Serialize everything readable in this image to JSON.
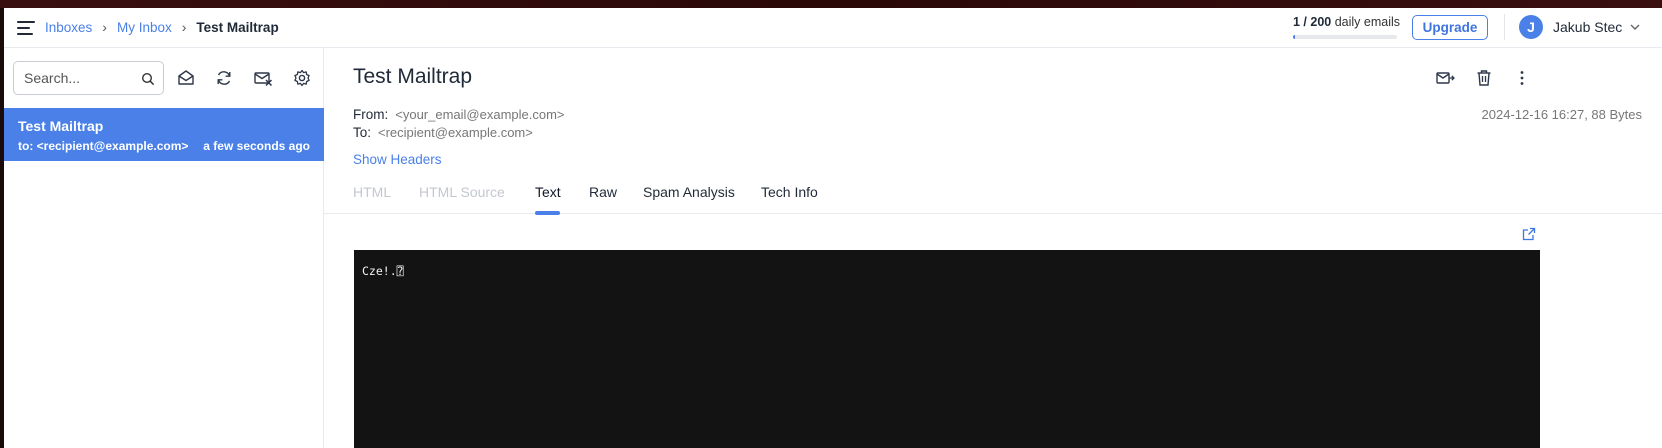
{
  "header": {
    "breadcrumbs": [
      "Inboxes",
      "My Inbox",
      "Test Mailtrap"
    ],
    "quota_used": "1 / 200",
    "quota_label": " daily emails",
    "quota_fraction": 0.005,
    "upgrade_label": "Upgrade",
    "user_initial": "J",
    "user_name": "Jakub Stec"
  },
  "sidebar": {
    "search_placeholder": "Search...",
    "toolbar_icons": [
      "mark-read-icon",
      "refresh-icon",
      "clear-inbox-icon",
      "settings-icon"
    ],
    "messages": [
      {
        "subject": "Test Mailtrap",
        "to": "to: <recipient@example.com>",
        "time": "a few seconds ago",
        "selected": true
      }
    ]
  },
  "message": {
    "subject": "Test Mailtrap",
    "from_label": "From:",
    "from_value": "<your_email@example.com>",
    "to_label": "To:",
    "to_value": "<recipient@example.com>",
    "meta": "2024-12-16 16:27, 88 Bytes",
    "show_headers": "Show Headers",
    "actions": [
      "forward-icon",
      "trash-icon",
      "more-vertical-icon"
    ],
    "tabs": [
      {
        "label": "HTML",
        "state": "disabled"
      },
      {
        "label": "HTML Source",
        "state": "disabled"
      },
      {
        "label": "Text",
        "state": "active"
      },
      {
        "label": "Raw",
        "state": "normal"
      },
      {
        "label": "Spam Analysis",
        "state": "normal"
      },
      {
        "label": "Tech Info",
        "state": "normal"
      }
    ],
    "body_text": "Cze!.⍰"
  },
  "colors": {
    "accent": "#4a80e8",
    "text": "#1f2937",
    "muted": "#777777",
    "body_bg": "#131313"
  }
}
